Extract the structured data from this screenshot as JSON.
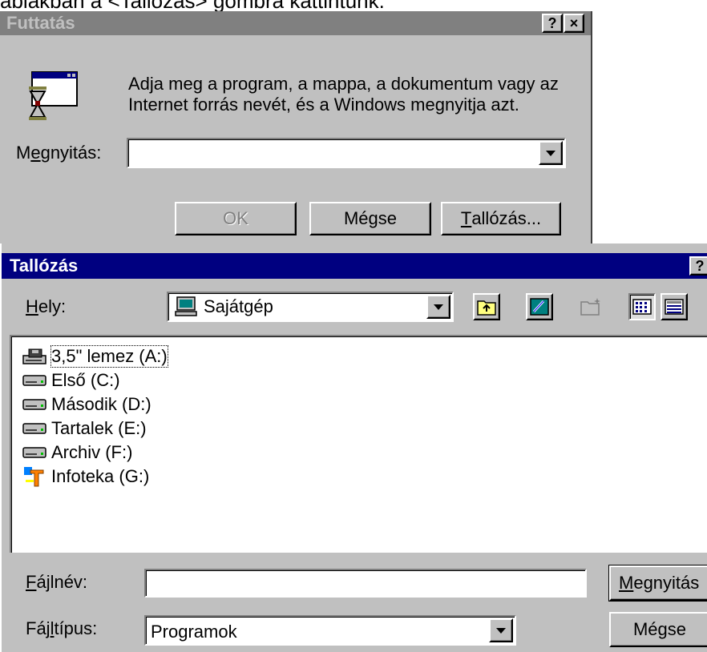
{
  "caption": "ablakban a <Tallózás> gombra kattintunk.",
  "run_dialog": {
    "title": "Futtatás",
    "help_button": "?",
    "close_button": "×",
    "description_line1": "Adja meg a program, a mappa, a dokumentum vagy az",
    "description_line2": "Internet forrás nevét, és a Windows megnyitja azt.",
    "open_label": "Megnyitás:",
    "open_value": "",
    "ok_label": "OK",
    "cancel_label": "Mégse",
    "browse_label": "Tallózás..."
  },
  "browse_dialog": {
    "title": "Tallózás",
    "help_button": "?",
    "location_label": "Hely:",
    "location_value": "Sajátgép",
    "items": [
      {
        "name": "3,5\" lemez (A:)",
        "icon": "floppy-drive-icon"
      },
      {
        "name": "Első (C:)",
        "icon": "hard-drive-icon"
      },
      {
        "name": "Második (D:)",
        "icon": "hard-drive-icon"
      },
      {
        "name": "Tartalek (E:)",
        "icon": "hard-drive-icon"
      },
      {
        "name": "Archiv (F:)",
        "icon": "hard-drive-icon"
      },
      {
        "name": "Infoteka (G:)",
        "icon": "cdrom-drive-icon"
      }
    ],
    "filename_label": "Fájlnév:",
    "filename_value": "",
    "filetype_label": "Fájltípus:",
    "filetype_value": "Programok",
    "open_button": "Megnyitás",
    "cancel_button": "Mégse"
  }
}
